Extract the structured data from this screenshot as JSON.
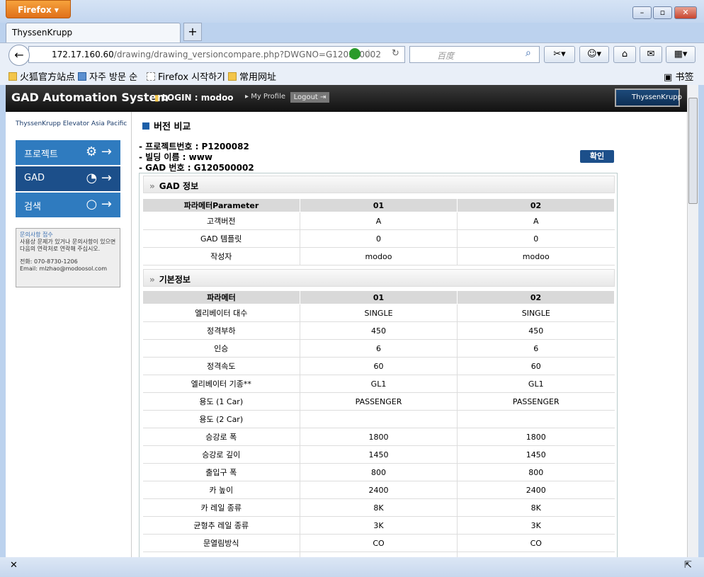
{
  "browser": {
    "menu_label": "Firefox",
    "tab_title": "ThyssenKrupp",
    "url_host": "172.17.160.60",
    "url_path": "/drawing/drawing_versioncompare.php?DWGNO=G120500002",
    "search_placeholder": "百度",
    "bookmarks": [
      "火狐官方站点",
      "자주 방문 순",
      "Firefox 시작하기",
      "常用网址"
    ],
    "bookmarks_menu": "书签"
  },
  "header": {
    "title": "GAD Automation System",
    "login": "LOGIN : modoo",
    "profile": "My Profile",
    "logout": "Logout",
    "brand": "ThyssenKrupp"
  },
  "sidebar": {
    "tagline": "ThyssenKrupp Elevator Asia Pacific",
    "items": [
      {
        "label": "프로젝트"
      },
      {
        "label": "GAD"
      },
      {
        "label": "검색"
      }
    ],
    "contact": {
      "title": "문의사항 접수",
      "body": "사용상 문제가 있거나 문의사항이 있으면 다음의 연락처로 연락해 주십시오.",
      "phone": "전화: 070-8730-1206",
      "email": "Email: mlzhao@modoosol.com"
    }
  },
  "main": {
    "title": "버전 비교",
    "project": "- 프로젝트번호 : P1200082",
    "building": "- 빌딩 이름 : www",
    "gad": "- GAD 번호 : G120500002",
    "confirm": "확인",
    "gad_section": {
      "title": "GAD 정보",
      "headers": [
        "파라메터Parameter",
        "01",
        "02"
      ],
      "rows": [
        [
          "고객버전",
          "A",
          "A"
        ],
        [
          "GAD 템플릿",
          "0",
          "0"
        ],
        [
          "작성자",
          "modoo",
          "modoo"
        ]
      ]
    },
    "basic_section": {
      "title": "기본정보",
      "headers": [
        "파라메터",
        "01",
        "02"
      ],
      "rows": [
        [
          "엘리베이터 대수",
          "SINGLE",
          "SINGLE"
        ],
        [
          "정격부하",
          "450",
          "450"
        ],
        [
          "인승",
          "6",
          "6"
        ],
        [
          "정격속도",
          "60",
          "60"
        ],
        [
          "엘리베이터 기종**",
          "GL1",
          "GL1"
        ],
        [
          "용도 (1 Car)",
          "PASSENGER",
          "PASSENGER"
        ],
        [
          "용도 (2 Car)",
          "",
          ""
        ],
        [
          "승강로 폭",
          "1800",
          "1800"
        ],
        [
          "승강로 깊이",
          "1450",
          "1450"
        ],
        [
          "출입구 폭",
          "800",
          "800"
        ],
        [
          "카 높이",
          "2400",
          "2400"
        ],
        [
          "카 레일 종류",
          "8K",
          "8K"
        ],
        [
          "균형추 레일 종류",
          "3K",
          "3K"
        ],
        [
          "문열림방식",
          "CO",
          "CO"
        ],
        [
          "",
          "",
          ""
        ]
      ]
    }
  }
}
